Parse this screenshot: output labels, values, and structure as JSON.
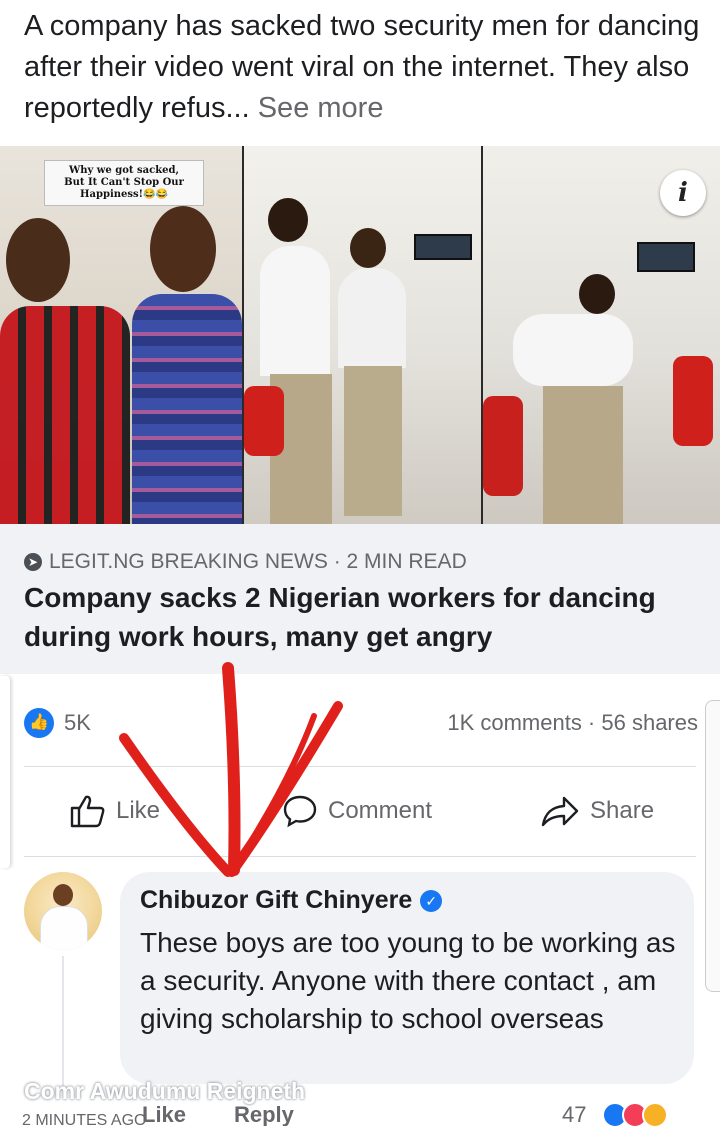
{
  "post": {
    "text": "A company has sacked two security men for dancing after their video went viral on the internet. They also reportedly refus...",
    "see_more": "See more"
  },
  "image": {
    "caption_line1": "Why we got sacked,",
    "caption_line2": "But It Can't Stop Our",
    "caption_line3": "Happiness!😂😂",
    "info_icon": "i"
  },
  "link_preview": {
    "source": "LEGIT.NG BREAKING NEWS · 2 MIN READ",
    "headline": "Company sacks 2 Nigerian workers for dancing during work hours, many get angry"
  },
  "reactions": {
    "like_count": "5K",
    "comments_shares": "1K comments · 56 shares"
  },
  "actions": {
    "like": "Like",
    "comment": "Comment",
    "share": "Share"
  },
  "comment": {
    "author": "Chibuzor Gift Chinyere",
    "text": "These boys are too young to be working as a security. Anyone with there contact , am giving scholarship to school overseas",
    "like": "Like",
    "reply": "Reply",
    "reaction_count": "47",
    "time": "2 MINUTES AGO"
  },
  "watermark": "Comr Awudumu Reigneth",
  "colors": {
    "facebook_blue": "#1877f2",
    "secondary_text": "#65676b",
    "annotation_red": "#e0211b"
  },
  "icons": [
    "info-icon",
    "source-icon",
    "like-badge-icon",
    "thumbs-up-icon",
    "comment-icon",
    "share-icon",
    "verified-icon",
    "red-arrow-annotation"
  ]
}
